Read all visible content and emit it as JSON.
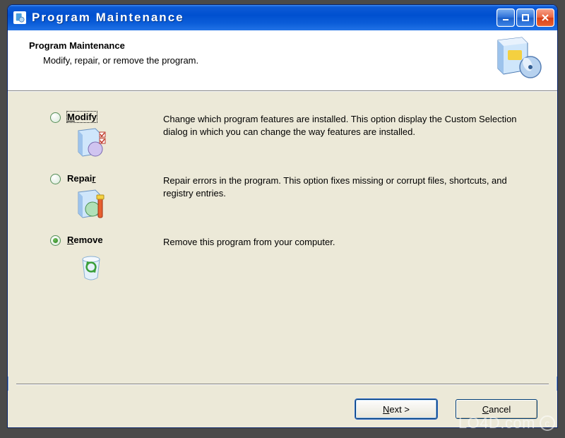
{
  "window": {
    "title": "Program Maintenance"
  },
  "header": {
    "title": "Program Maintenance",
    "subtitle": "Modify, repair, or remove the program."
  },
  "options": {
    "modify": {
      "label": "Modify",
      "description": "Change which program features are installed. This option display the Custom Selection dialog in which you can change the way features are installed.",
      "selected": false,
      "focused": true
    },
    "repair": {
      "label": "Repair",
      "description": "Repair errors in the program. This option fixes missing or corrupt files, shortcuts, and registry entries.",
      "selected": false,
      "focused": false
    },
    "remove": {
      "label": "Remove",
      "description": "Remove this program from your computer.",
      "selected": true,
      "focused": false
    }
  },
  "footer": {
    "next": "Next >",
    "cancel": "Cancel"
  },
  "watermark": "LO4D.com"
}
